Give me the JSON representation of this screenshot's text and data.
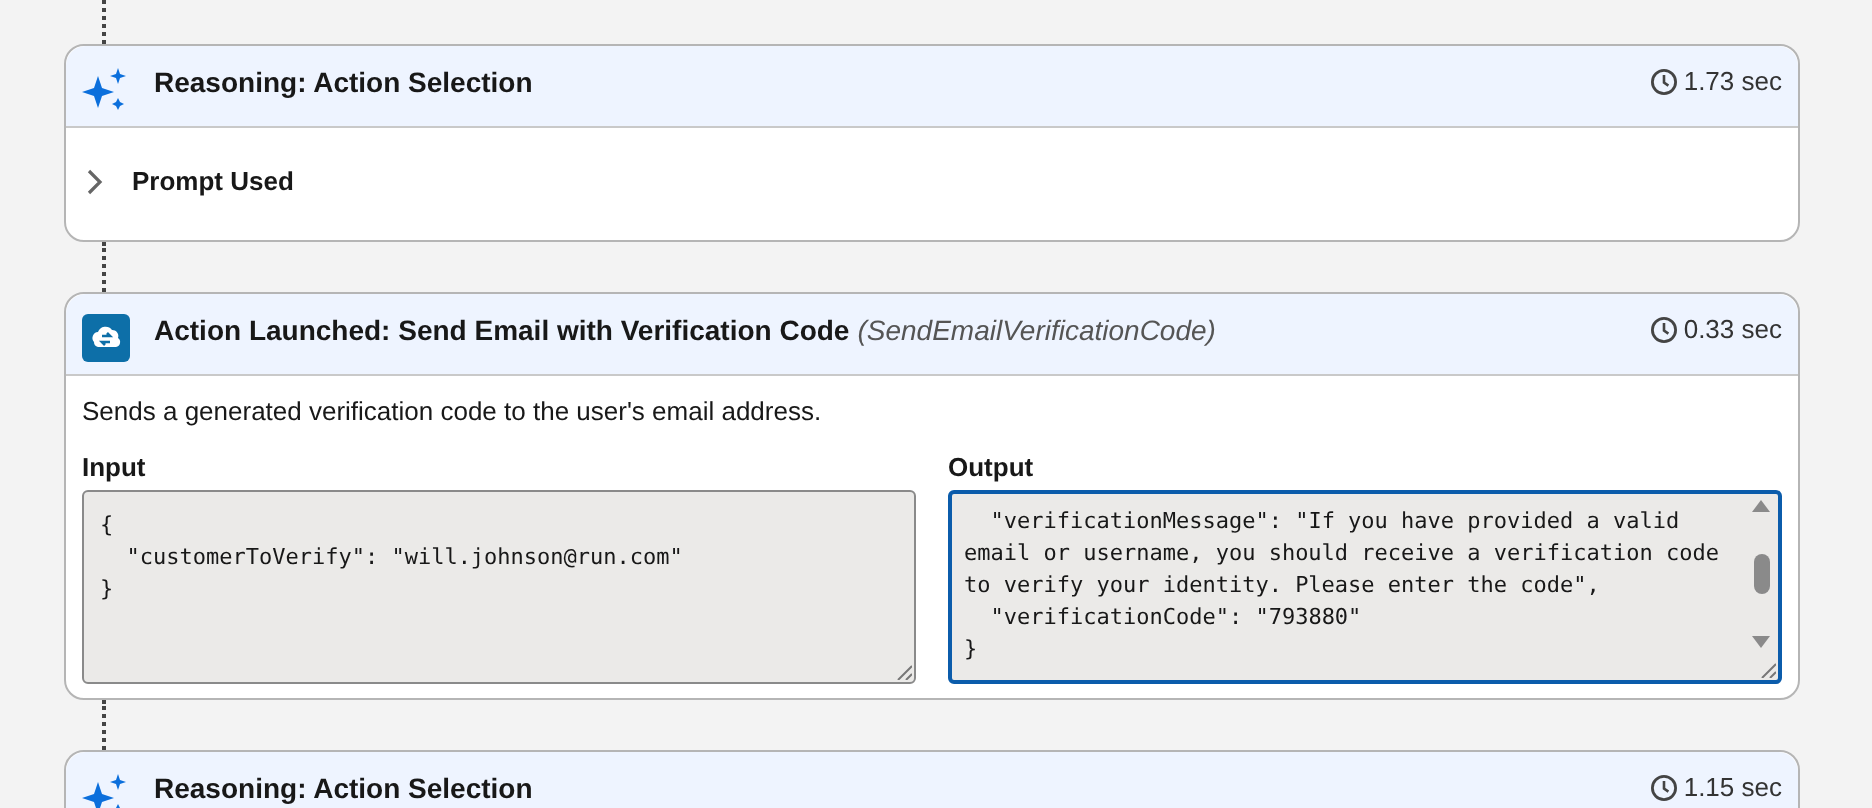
{
  "steps": [
    {
      "kind": "reasoning",
      "title": "Reasoning: Action Selection",
      "duration": "1.73 sec",
      "sections": [
        {
          "label": "Prompt Used",
          "expanded": false
        }
      ]
    },
    {
      "kind": "action",
      "title": "Action Launched: Send Email with Verification Code",
      "api_name": "(SendEmailVerificationCode)",
      "duration": "0.33 sec",
      "description": "Sends a generated verification code to the user's email address.",
      "input": {
        "label": "Input",
        "value": "{\n  \"customerToVerify\": \"will.johnson@run.com\"\n}",
        "focused": false
      },
      "output": {
        "label": "Output",
        "value": "  \"verificationMessage\": \"If you have provided a valid\nemail or username, you should receive a verification code\nto verify your identity. Please enter the code\",\n  \"verificationCode\": \"793880\"\n}",
        "focused": true
      }
    },
    {
      "kind": "reasoning",
      "title": "Reasoning: Action Selection",
      "duration": "1.15 sec"
    }
  ]
}
